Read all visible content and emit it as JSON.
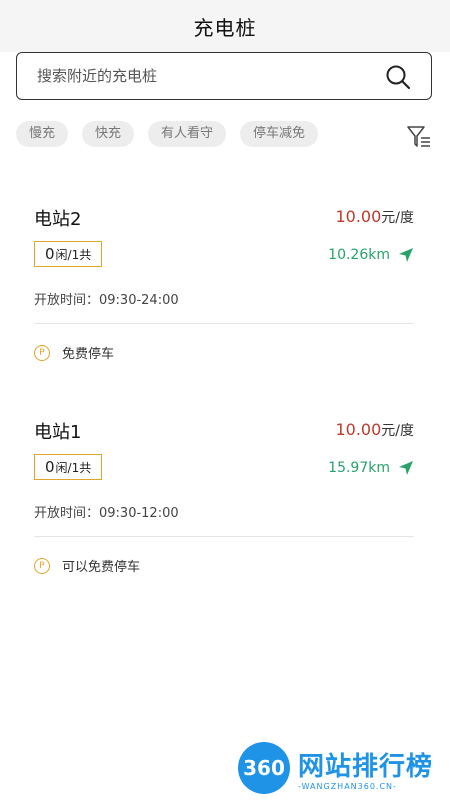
{
  "header": {
    "title": "充电桩"
  },
  "search": {
    "placeholder": "搜索附近的充电桩"
  },
  "filters": [
    "慢充",
    "快充",
    "有人看守",
    "停车减免"
  ],
  "stations": [
    {
      "name": "电站2",
      "price": "10.00",
      "price_unit": "元/度",
      "idle": "0",
      "idle_suffix": "闲/1共",
      "distance": "10.26km",
      "hours": "开放时间：09:30-24:00",
      "parking": "免费停车"
    },
    {
      "name": "电站1",
      "price": "10.00",
      "price_unit": "元/度",
      "idle": "0",
      "idle_suffix": "闲/1共",
      "distance": "15.97km",
      "hours": "开放时间：09:30-12:00",
      "parking": "可以免费停车"
    }
  ],
  "colors": {
    "price": "#c0392b",
    "distance": "#27a36a",
    "accent_border": "#e0a52a",
    "header_bg": "#f5f5f5"
  },
  "watermark": {
    "badge": "360",
    "name": "网站排行榜",
    "url": "-WANGZHAN360.CN-"
  }
}
